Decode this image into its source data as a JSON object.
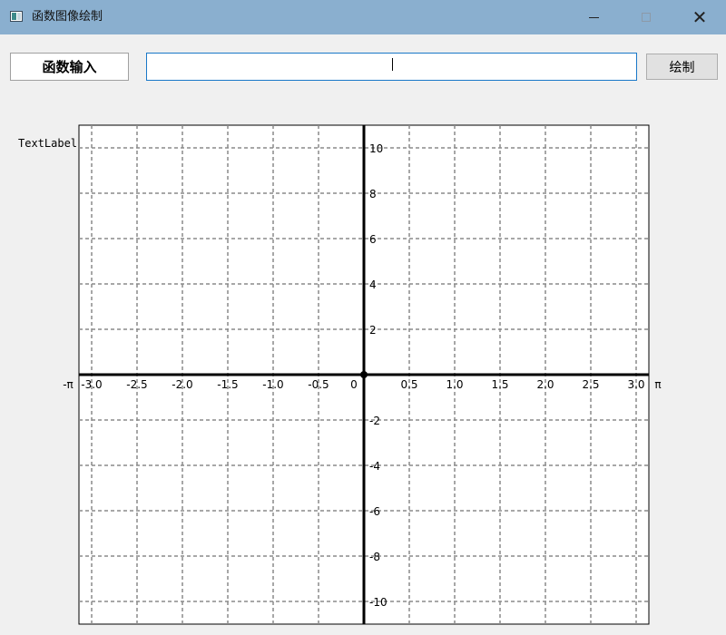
{
  "window": {
    "title": "函数图像绘制",
    "icon": "app-window-icon"
  },
  "toolbar": {
    "label": "函数输入",
    "input_value": "",
    "draw_label": "绘制"
  },
  "text_label": "TextLabel",
  "chart_data": {
    "type": "line",
    "xlim": [
      -3.14159,
      3.14159
    ],
    "ylim": [
      -11,
      11
    ],
    "grid": true,
    "x_ticks": [
      {
        "v": -3.0,
        "label": "-3.0"
      },
      {
        "v": -2.5,
        "label": "-2.5"
      },
      {
        "v": -2.0,
        "label": "-2.0"
      },
      {
        "v": -1.5,
        "label": "-1.5"
      },
      {
        "v": -1.0,
        "label": "-1.0"
      },
      {
        "v": -0.5,
        "label": "-0.5"
      },
      {
        "v": 0,
        "label": "0"
      },
      {
        "v": 0.5,
        "label": "0.5"
      },
      {
        "v": 1.0,
        "label": "1.0"
      },
      {
        "v": 1.5,
        "label": "1.5"
      },
      {
        "v": 2.0,
        "label": "2.0"
      },
      {
        "v": 2.5,
        "label": "2.5"
      },
      {
        "v": 3.0,
        "label": "3.0"
      }
    ],
    "x_end_labels": {
      "min": "-π",
      "max": "π"
    },
    "y_ticks": [
      {
        "v": 10,
        "label": "10"
      },
      {
        "v": 8,
        "label": "8"
      },
      {
        "v": 6,
        "label": "6"
      },
      {
        "v": 4,
        "label": "4"
      },
      {
        "v": 2,
        "label": "2"
      },
      {
        "v": -2,
        "label": "-2"
      },
      {
        "v": -4,
        "label": "-4"
      },
      {
        "v": -6,
        "label": "-6"
      },
      {
        "v": -8,
        "label": "-8"
      },
      {
        "v": -10,
        "label": "-10"
      }
    ],
    "series": []
  }
}
